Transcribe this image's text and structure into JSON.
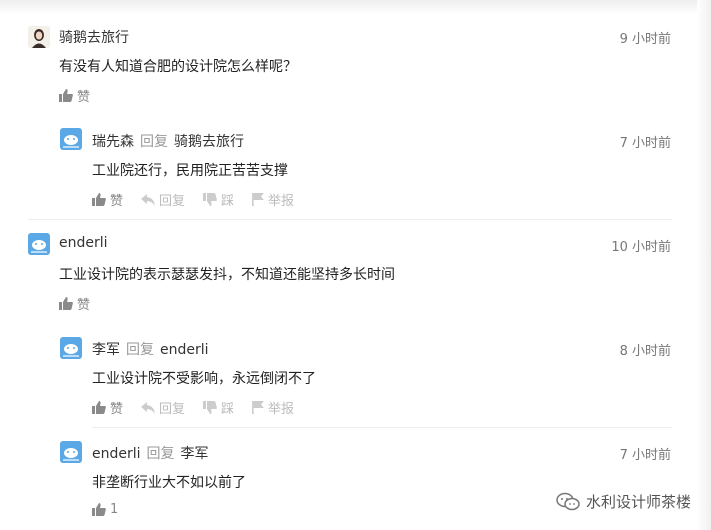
{
  "actions_labels": {
    "like": "赞",
    "reply": "回复",
    "dislike": "踩",
    "report": "举报"
  },
  "comments": [
    {
      "user": "骑鹅去旅行",
      "time": "9 小时前",
      "content": "有没有人知道合肥的设计院怎么样呢？",
      "like_label": "赞"
    },
    {
      "user": "瑞先森",
      "reply_word": "回复",
      "reply_to": "骑鹅去旅行",
      "time": "7 小时前",
      "content": "工业院还行，民用院正苦苦支撑",
      "like_label": "赞"
    },
    {
      "user": "enderli",
      "time": "10 小时前",
      "content": "工业设计院的表示瑟瑟发抖，不知道还能坚持多长时间",
      "like_label": "赞"
    },
    {
      "user": "李军",
      "reply_word": "回复",
      "reply_to": "enderli",
      "time": "8 小时前",
      "content": "工业设计院不受影响，永远倒闭不了",
      "like_label": "赞"
    },
    {
      "user": "enderli",
      "reply_word": "回复",
      "reply_to": "李军",
      "time": "7 小时前",
      "content": "非垄断行业大不如以前了",
      "like_count": "1"
    }
  ],
  "watermark": "水利设计师茶楼",
  "colors": {
    "avatar_blue": "#5aa9e6",
    "muted": "#aaaaaa",
    "text": "#222222"
  }
}
